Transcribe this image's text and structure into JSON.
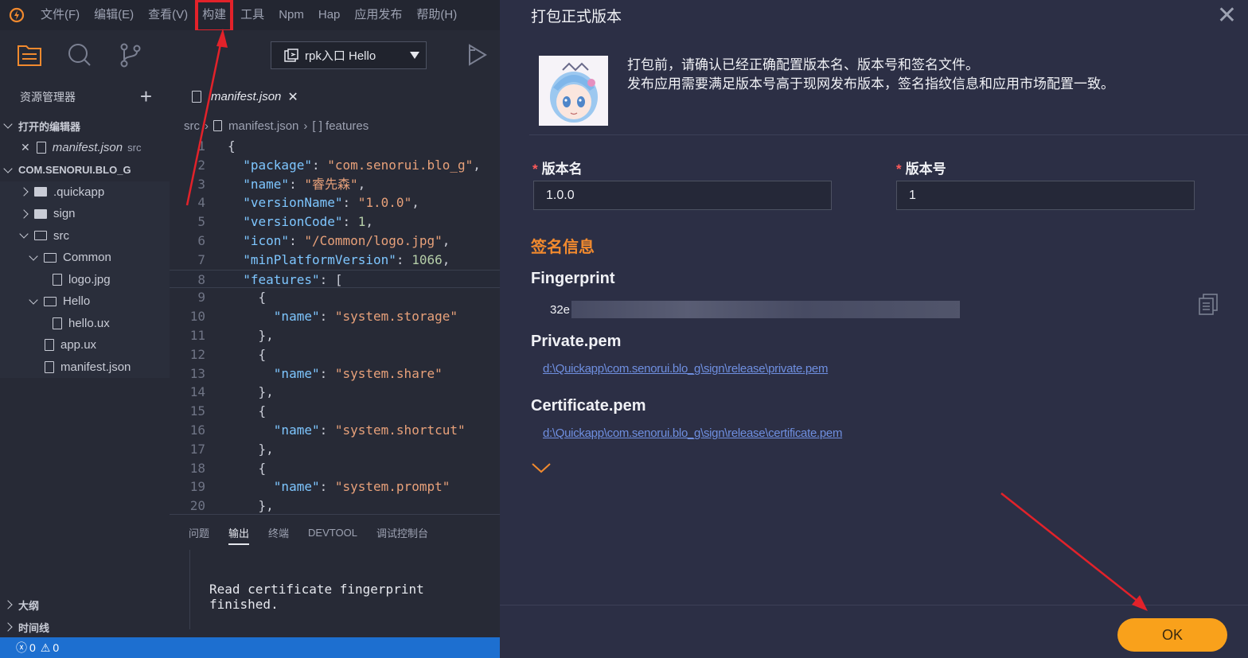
{
  "menubar": {
    "items": [
      "文件(F)",
      "编辑(E)",
      "查看(V)",
      "构建",
      "工具",
      "Npm",
      "Hap",
      "应用发布",
      "帮助(H)"
    ]
  },
  "toolbar": {
    "run_target": "rpk入口 Hello"
  },
  "sidebar": {
    "title": "资源管理器",
    "open_editors_label": "打开的编辑器",
    "open_editor_file": "manifest.json",
    "open_editor_dir": "src",
    "project_label": "COM.SENORUI.BLO_G",
    "tree": [
      ".quickapp",
      "sign",
      "src",
      "Common",
      "logo.jpg",
      "Hello",
      "hello.ux",
      "app.ux",
      "manifest.json"
    ],
    "outline_label": "大纲",
    "timeline_label": "时间线"
  },
  "editor": {
    "tab_label": "manifest.json",
    "breadcrumb": [
      "src",
      "manifest.json",
      "[ ] features"
    ],
    "lines": [
      {
        "n": "1"
      },
      {
        "n": "2"
      },
      {
        "n": "3"
      },
      {
        "n": "4"
      },
      {
        "n": "5"
      },
      {
        "n": "6"
      },
      {
        "n": "7"
      },
      {
        "n": "8"
      },
      {
        "n": "9"
      },
      {
        "n": "10"
      },
      {
        "n": "11"
      },
      {
        "n": "12"
      },
      {
        "n": "13"
      },
      {
        "n": "14"
      },
      {
        "n": "15"
      },
      {
        "n": "16"
      },
      {
        "n": "17"
      },
      {
        "n": "18"
      },
      {
        "n": "19"
      },
      {
        "n": "20"
      }
    ],
    "code": {
      "package_key": "\"package\"",
      "package_val": "\"com.senorui.blo_g\"",
      "name_key": "\"name\"",
      "name_val": "\"睿先森\"",
      "vn_key": "\"versionName\"",
      "vn_val": "\"1.0.0\"",
      "vc_key": "\"versionCode\"",
      "vc_val": "1",
      "icon_key": "\"icon\"",
      "icon_val": "\"/Common/logo.jpg\"",
      "mpv_key": "\"minPlatformVersion\"",
      "mpv_val": "1066",
      "features_key": "\"features\"",
      "f_name_key": "\"name\"",
      "f1": "\"system.storage\"",
      "f2": "\"system.share\"",
      "f3": "\"system.shortcut\"",
      "f4": "\"system.prompt\""
    }
  },
  "panel": {
    "tabs": [
      "问题",
      "输出",
      "终端",
      "DEVTOOL",
      "调试控制台"
    ],
    "output_text": "Read certificate fingerprint finished."
  },
  "statusbar": {
    "errors": "0",
    "warnings": "0"
  },
  "dialog": {
    "title": "打包正式版本",
    "info_line1": "打包前，请确认已经正确配置版本名、版本号和签名文件。",
    "info_line2": "发布应用需要满足版本号高于现网发布版本，签名指纹信息和应用市场配置一致。",
    "version_name_label": "版本名",
    "version_name_value": "1.0.0",
    "version_code_label": "版本号",
    "version_code_value": "1",
    "sign_title": "签名信息",
    "fingerprint_label": "Fingerprint",
    "fingerprint_prefix": "32e",
    "private_label": "Private.pem",
    "private_path": "d:\\Quickapp\\com.senorui.blo_g\\sign\\release\\private.pem",
    "cert_label": "Certificate.pem",
    "cert_path": "d:\\Quickapp\\com.senorui.blo_g\\sign\\release\\certificate.pem",
    "ok_label": "OK"
  },
  "colors": {
    "accent_orange": "#f9a11b",
    "sign_title": "#f28a2e",
    "highlight_box": "#e2222a",
    "statusbar": "#1d6fd0"
  }
}
